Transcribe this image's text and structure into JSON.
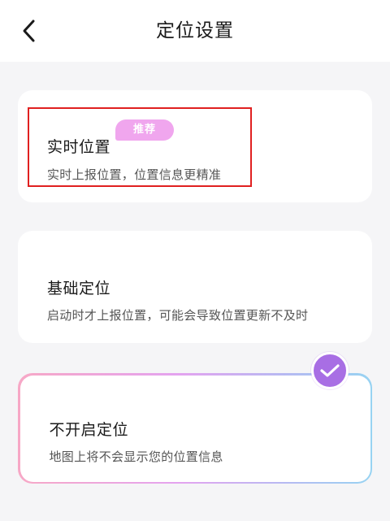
{
  "header": {
    "title": "定位设置",
    "back_icon": "chevron-left-icon"
  },
  "options": [
    {
      "title": "实时位置",
      "badge": "推荐",
      "description": "实时上报位置，位置信息更精准",
      "selected": false,
      "highlighted": true
    },
    {
      "title": "基础定位",
      "description": "启动时才上报位置，可能会导致位置更新不及时",
      "selected": false
    },
    {
      "title": "不开启定位",
      "description": "地图上将不会显示您的位置信息",
      "selected": true
    }
  ],
  "colors": {
    "badge": "#f0a6ee",
    "highlight": "#e02020",
    "check": "#a86ee4",
    "gradient_start": "#f7a8c6",
    "gradient_end": "#97d3f2"
  }
}
